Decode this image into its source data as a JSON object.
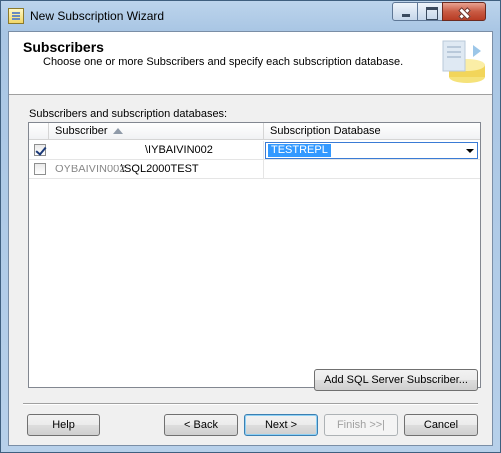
{
  "window": {
    "title": "New Subscription Wizard"
  },
  "header": {
    "title": "Subscribers",
    "subtitle": "Choose one or more Subscribers and specify each subscription database."
  },
  "grid": {
    "label": "Subscribers and subscription databases:",
    "columns": [
      "Subscriber",
      "Subscription Database"
    ],
    "rows": [
      {
        "checked": true,
        "subscriber": "\\IYBAIVIN002",
        "database": "TESTREPL"
      },
      {
        "checked": false,
        "subscriber": "\\SQL2000TEST",
        "database": ""
      }
    ]
  },
  "buttons": {
    "add_subscriber": "Add SQL Server Subscriber...",
    "help": "Help",
    "back": "< Back",
    "next": "Next >",
    "finish": "Finish >>|",
    "cancel": "Cancel"
  },
  "colors": {
    "selection": "#3399ff",
    "title_bar": "#bcd4ec",
    "close_button": "#c95b44"
  }
}
